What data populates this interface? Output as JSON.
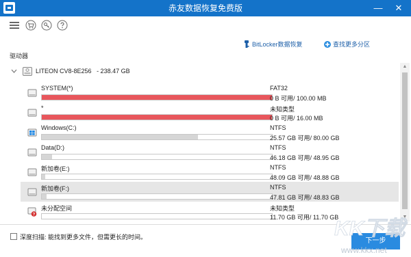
{
  "window": {
    "title": "赤友数据恢复免费版",
    "minimize_glyph": "—",
    "close_glyph": "✕"
  },
  "toolbar": {
    "icons": [
      "menu-icon",
      "cart-icon",
      "key-icon",
      "help-icon"
    ]
  },
  "links": {
    "bitlocker": "BitLocker数据恢复",
    "find_partitions": "查找更多分区"
  },
  "drives_label": "驱动器",
  "disk": {
    "model": "LITEON CV8-8E256",
    "size": "- 238.47 GB"
  },
  "partitions": [
    {
      "name": "SYSTEM(*)",
      "fs": "FAT32",
      "usage": "0 B 可用/ 100.00 MB",
      "used_fraction": 1.0,
      "bar_color": "#e8565c",
      "icon": "drive-icon",
      "selected": false
    },
    {
      "name": "*",
      "fs": "未知类型",
      "usage": "0 B 可用/ 16.00 MB",
      "used_fraction": 1.0,
      "bar_color": "#e8565c",
      "icon": "drive-icon",
      "selected": false
    },
    {
      "name": "Windows(C:)",
      "fs": "NTFS",
      "usage": "25.57 GB 可用/ 80.00 GB",
      "used_fraction": 0.68,
      "bar_color": "#d6d6d6",
      "icon": "windows-drive-icon",
      "selected": false
    },
    {
      "name": "Data(D:)",
      "fs": "NTFS",
      "usage": "46.18 GB 可用/ 48.95 GB",
      "used_fraction": 0.044,
      "bar_color": "#d6d6d6",
      "icon": "drive-icon",
      "selected": false
    },
    {
      "name": "新加卷(E:)",
      "fs": "NTFS",
      "usage": "48.09 GB 可用/ 48.88 GB",
      "used_fraction": 0.016,
      "bar_color": "#d6d6d6",
      "icon": "drive-icon",
      "selected": false
    },
    {
      "name": "新加卷(F:)",
      "fs": "NTFS",
      "usage": "47.81 GB 可用/ 48.83 GB",
      "used_fraction": 0.021,
      "bar_color": "#d6d6d6",
      "icon": "drive-icon",
      "selected": true
    },
    {
      "name": "未分配空间",
      "fs": "未知类型",
      "usage": "11.70 GB 可用/ 11.70 GB",
      "used_fraction": 0.0,
      "bar_color": "#d6d6d6",
      "icon": "unallocated-icon",
      "selected": false
    }
  ],
  "footer": {
    "deep_scan_label": "深度扫描: 能找到更多文件，但需更长的时间。",
    "next_label": "下一步"
  },
  "watermark": {
    "line1": "KK下载",
    "line2": "www.kkx.net"
  },
  "colors": {
    "titlebar": "#1473c9",
    "accent_link": "#1d5fa8",
    "used_red": "#e8565c",
    "button_blue": "#2a8be0"
  }
}
